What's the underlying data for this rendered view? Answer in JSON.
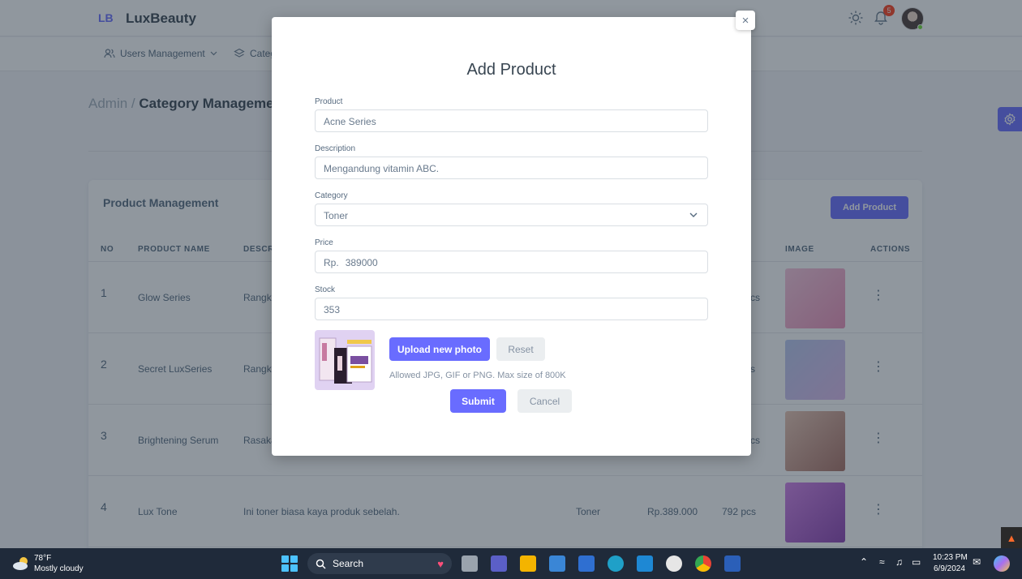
{
  "app": {
    "logo_mark": "LB",
    "name": "LuxBeauty",
    "notification_count": "5"
  },
  "menu": {
    "users_management": "Users Management",
    "categories_partial": "Categ"
  },
  "breadcrumb": {
    "root": "Admin / ",
    "current": "Category Managemen"
  },
  "card": {
    "title": "Product Management",
    "add_button": "Add Product",
    "columns": {
      "no": "NO",
      "product_name": "PRODUCT NAME",
      "description": "DESCR",
      "image": "IMAGE",
      "actions": "ACTIONS"
    },
    "rows": [
      {
        "no": "1",
        "name": "Glow Series",
        "desc": "Rangk",
        "category": "",
        "price": "",
        "stock": "cs",
        "thumb_color": "#f3a8c9"
      },
      {
        "no": "2",
        "name": "Secret LuxSeries",
        "desc": "Rangk",
        "category": "",
        "price": "",
        "stock": "s",
        "thumb_color": "#c8b6ec"
      },
      {
        "no": "3",
        "name": "Brightening Serum",
        "desc": "Rasaka",
        "category": "",
        "price": "",
        "stock": "cs",
        "thumb_color": "#c98f80"
      },
      {
        "no": "4",
        "name": "Lux Tone",
        "desc": "Ini toner biasa kaya produk sebelah.",
        "category": "Toner",
        "price": "Rp.389.000",
        "stock": "792 pcs",
        "thumb_color": "#b45fcf"
      }
    ]
  },
  "modal": {
    "title": "Add Product",
    "close_glyph": "×",
    "product_label": "Product",
    "product_value": "Acne Series",
    "description_label": "Description",
    "description_value": "Mengandung vitamin ABC.",
    "category_label": "Category",
    "category_value": "Toner",
    "price_label": "Price",
    "price_prefix": "Rp.",
    "price_value": "389000",
    "stock_label": "Stock",
    "stock_value": "353",
    "upload_button": "Upload new photo",
    "reset_button": "Reset",
    "hint": "Allowed JPG, GIF or PNG. Max size of 800K",
    "submit_button": "Submit",
    "cancel_button": "Cancel"
  },
  "taskbar": {
    "temperature": "78°F",
    "weather": "Mostly cloudy",
    "search": "Search",
    "time": "10:23 PM",
    "date": "6/9/2024"
  }
}
